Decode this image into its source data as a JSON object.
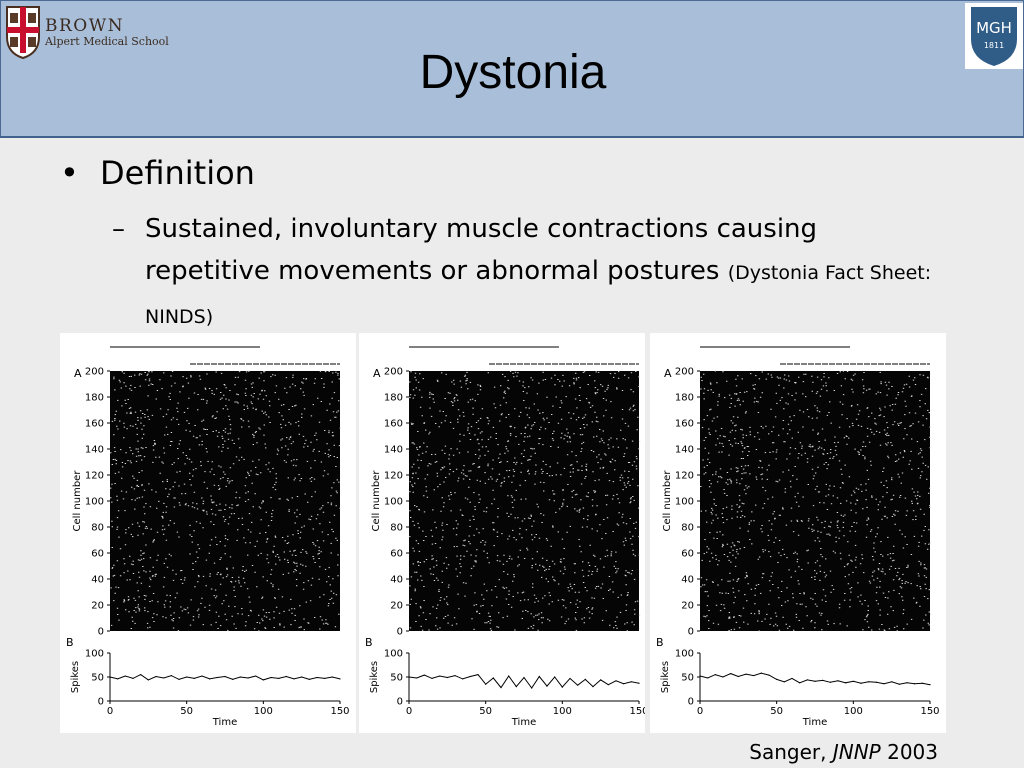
{
  "header": {
    "brown_name": "BROWN",
    "brown_sub": "Alpert Medical School",
    "mgh_name": "MGH",
    "mgh_year": "1811",
    "title": "Dystonia"
  },
  "content": {
    "bullet1": "Definition",
    "bullet2_text": "Sustained, involuntary muscle contractions causing repetitive movements or abnormal postures",
    "bullet2_cite": "(Dystonia Fact Sheet: NINDS)"
  },
  "figure": {
    "panel_a_letter": "A",
    "panel_b_letter": "B",
    "a_ylabel": "Cell number",
    "b_ylabel": "Spikes",
    "xlabel": "Time",
    "a_yticks": [
      "0",
      "20",
      "40",
      "60",
      "80",
      "100",
      "120",
      "140",
      "160",
      "180",
      "200"
    ],
    "b_yticks": [
      "0",
      "50",
      "100"
    ],
    "xticks": [
      "0",
      "50",
      "100",
      "150"
    ]
  },
  "citation": {
    "author": "Sanger, ",
    "journal": "JNNP",
    "year": " 2003"
  },
  "chart_data": [
    {
      "type": "line",
      "panel": "left",
      "title": "",
      "xlabel": "Time",
      "ylabel": "Spikes",
      "xlim": [
        0,
        150
      ],
      "ylim": [
        0,
        100
      ],
      "raster_ylabel": "Cell number",
      "raster_ylim": [
        0,
        200
      ],
      "x": [
        0,
        5,
        10,
        15,
        20,
        25,
        30,
        35,
        40,
        45,
        50,
        55,
        60,
        65,
        70,
        75,
        80,
        85,
        90,
        95,
        100,
        105,
        110,
        115,
        120,
        125,
        130,
        135,
        140,
        145,
        150
      ],
      "series": [
        {
          "values": [
            50,
            46,
            52,
            47,
            55,
            44,
            51,
            48,
            53,
            45,
            50,
            47,
            52,
            46,
            49,
            51,
            45,
            50,
            48,
            52,
            44,
            49,
            47,
            51,
            46,
            50,
            45,
            49,
            47,
            50,
            46
          ]
        }
      ]
    },
    {
      "type": "line",
      "panel": "middle",
      "title": "",
      "xlabel": "Time",
      "ylabel": "Spikes",
      "xlim": [
        0,
        150
      ],
      "ylim": [
        0,
        100
      ],
      "raster_ylabel": "Cell number",
      "raster_ylim": [
        0,
        200
      ],
      "x": [
        0,
        5,
        10,
        15,
        20,
        25,
        30,
        35,
        40,
        45,
        50,
        55,
        60,
        65,
        70,
        75,
        80,
        85,
        90,
        95,
        100,
        105,
        110,
        115,
        120,
        125,
        130,
        135,
        140,
        145,
        150
      ],
      "series": [
        {
          "values": [
            50,
            48,
            54,
            47,
            52,
            49,
            53,
            46,
            51,
            55,
            35,
            48,
            28,
            52,
            30,
            49,
            27,
            51,
            31,
            50,
            29,
            47,
            33,
            45,
            30,
            44,
            34,
            42,
            36,
            40,
            37
          ]
        }
      ]
    },
    {
      "type": "line",
      "panel": "right",
      "title": "",
      "xlabel": "Time",
      "ylabel": "Spikes",
      "xlim": [
        0,
        150
      ],
      "ylim": [
        0,
        100
      ],
      "raster_ylabel": "Cell number",
      "raster_ylim": [
        0,
        200
      ],
      "x": [
        0,
        5,
        10,
        15,
        20,
        25,
        30,
        35,
        40,
        45,
        50,
        55,
        60,
        65,
        70,
        75,
        80,
        85,
        90,
        95,
        100,
        105,
        110,
        115,
        120,
        125,
        130,
        135,
        140,
        145,
        150
      ],
      "series": [
        {
          "values": [
            52,
            48,
            55,
            50,
            57,
            51,
            56,
            53,
            58,
            54,
            45,
            40,
            47,
            38,
            44,
            41,
            43,
            39,
            42,
            38,
            41,
            37,
            40,
            39,
            36,
            40,
            35,
            38,
            36,
            37,
            34
          ]
        }
      ]
    }
  ]
}
